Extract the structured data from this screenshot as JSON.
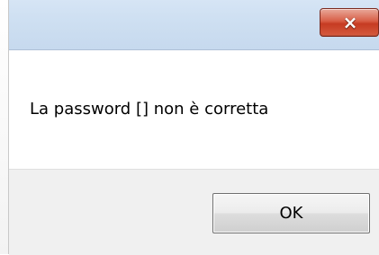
{
  "dialog": {
    "message": "La password [] non è corretta",
    "close_icon": "×",
    "ok_label": "OK"
  },
  "icons": {
    "close": "close-icon"
  },
  "colors": {
    "titlebar": "#cfe0f2",
    "close_button": "#d85e46",
    "footer": "#f0f0f0",
    "text": "#000000"
  }
}
